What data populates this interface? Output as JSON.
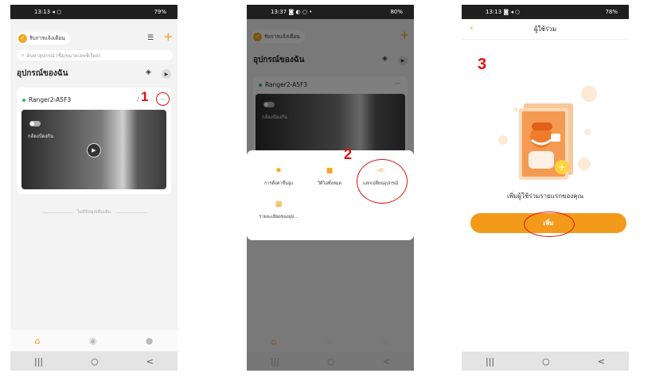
{
  "screens": [
    {
      "status_time": "13:13",
      "status_icons": "◂ ○",
      "status_right": "79%",
      "notify_label": "รับการแจ้งเตือน",
      "search_placeholder": "ค้นหาอุปกรณ์ (ชื่อ/หมายเลขซีเรียล)",
      "section_title": "อุปกรณ์ของฉัน",
      "device_name": "Ranger2-A5F3",
      "privacy_label": "กล้องป้องกัน",
      "no_more_label": "ไม่มีข้อมูลเพิ่มเติม",
      "step": "1"
    },
    {
      "status_time": "13:37",
      "status_icons": "◙ ◐ ○ •",
      "status_right": "80%",
      "notify_label": "รับการแจ้งเตือน",
      "section_title": "อุปกรณ์ของฉัน",
      "device_name": "Ranger2-A5F3",
      "privacy_label": "กล้องป้องกัน",
      "step": "2",
      "menu": [
        {
          "icon": "gear-icon",
          "label": "การตั้งค่าขั้นสูง"
        },
        {
          "icon": "video-icon",
          "label": "วิดีโอทั้งหมด"
        },
        {
          "icon": "share-icon",
          "label": "แลกเปลี่ยนอุปกรณ์"
        },
        {
          "icon": "grid-icon",
          "label": "รายละเอียดของอุป..."
        }
      ]
    },
    {
      "status_time": "13:13",
      "status_icons": "◙ ◂ ○",
      "status_right": "78%",
      "header_title": "ผู้ใช้ร่วม",
      "step": "3",
      "caption": "เพิ่มผู้ใช้ร่วมรายแรกของคุณ",
      "add_button": "เพิ่ม"
    }
  ],
  "colors": {
    "accent": "#f39a1a",
    "annotation": "#e01010",
    "online": "#27c24c"
  },
  "nav_keys": [
    "|||",
    "○",
    "<"
  ]
}
